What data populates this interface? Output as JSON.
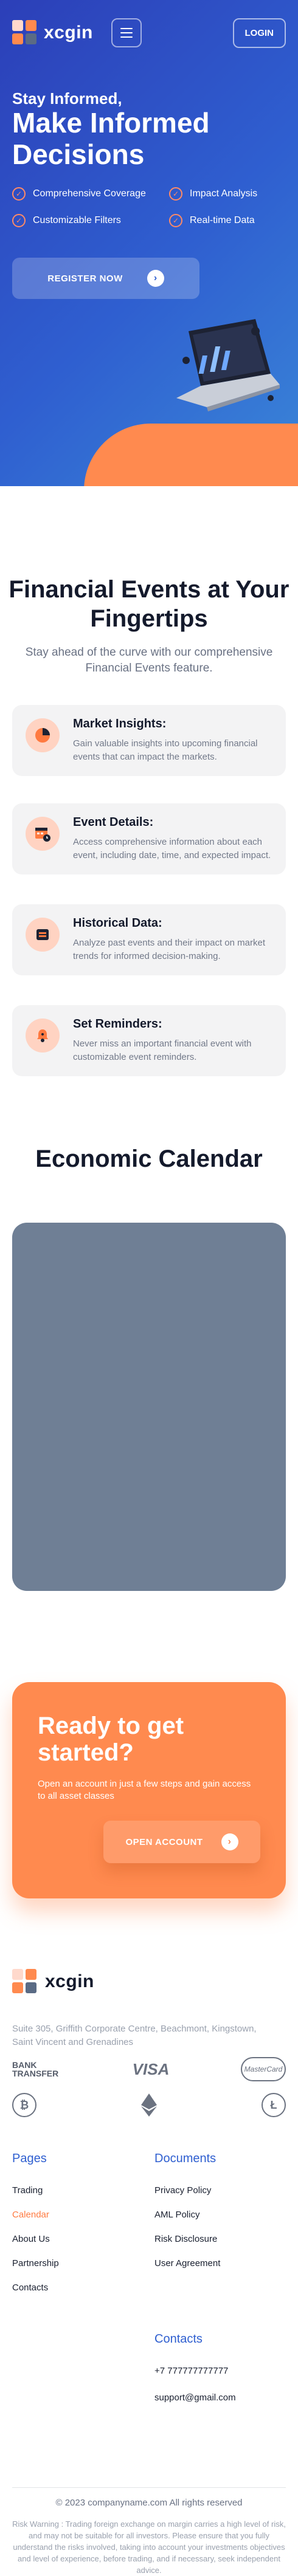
{
  "brand": {
    "name": "xcgin"
  },
  "header": {
    "login_label": "LOGIN",
    "menu_icon": "hamburger-menu-icon"
  },
  "hero": {
    "subtitle": "Stay Informed,",
    "title": "Make Informed Decisions",
    "features": [
      "Comprehensive Coverage",
      "Impact Analysis",
      "Customizable Filters",
      "Real-time Data"
    ],
    "register_label": "REGISTER NOW"
  },
  "events": {
    "title": "Financial Events at Your Fingertips",
    "subtitle": "Stay ahead of the curve with our comprehensive Financial Events feature.",
    "cards": [
      {
        "title": "Market Insights:",
        "text": "Gain valuable insights into upcoming financial events that can impact the markets.",
        "icon": "pie-chart-icon"
      },
      {
        "title": "Event Details:",
        "text": "Access comprehensive information about each event, including date, time, and expected impact.",
        "icon": "calendar-clock-icon"
      },
      {
        "title": "Historical Data:",
        "text": "Analyze past events and their impact on market trends for informed decision-making.",
        "icon": "wallet-icon"
      },
      {
        "title": "Set Reminders:",
        "text": "Never miss an important financial event with customizable event reminders.",
        "icon": "bell-icon"
      }
    ]
  },
  "calendar": {
    "title": "Economic Calendar"
  },
  "cta": {
    "title": "Ready to get started?",
    "text": "Open an account in just a few steps and gain access to all asset classes",
    "button_label": "OPEN ACCOUNT"
  },
  "footer": {
    "address": "Suite 305, Griffith Corporate Centre, Beachmont, Kingstown, Saint Vincent and Grenadines",
    "payments": {
      "bank": "BANK TRANSFER",
      "visa": "VISA",
      "mastercard": "MasterCard"
    },
    "pages_title": "Pages",
    "pages": [
      "Trading",
      "Calendar",
      "About Us",
      "Partnership",
      "Contacts"
    ],
    "documents_title": "Documents",
    "documents": [
      "Privacy Policy",
      "AML Policy",
      "Risk Disclosure",
      "User Agreement"
    ],
    "contacts_title": "Contacts",
    "phone": "+7 777777777777",
    "email": "support@gmail.com",
    "copyright": "© 2023 companyname.com All rights reserved",
    "risk": "Risk Warning : Trading foreign exchange on margin carries a high level of risk, and may not be suitable for all investors. Please ensure that you fully understand the risks involved, taking into account your investments objectives and level of experience, before trading, and if necessary, seek independent advice."
  },
  "colors": {
    "accent": "#ff8a4f",
    "brand_blue": "#2f5fd0",
    "calendar_placeholder": "#6f7f95"
  }
}
